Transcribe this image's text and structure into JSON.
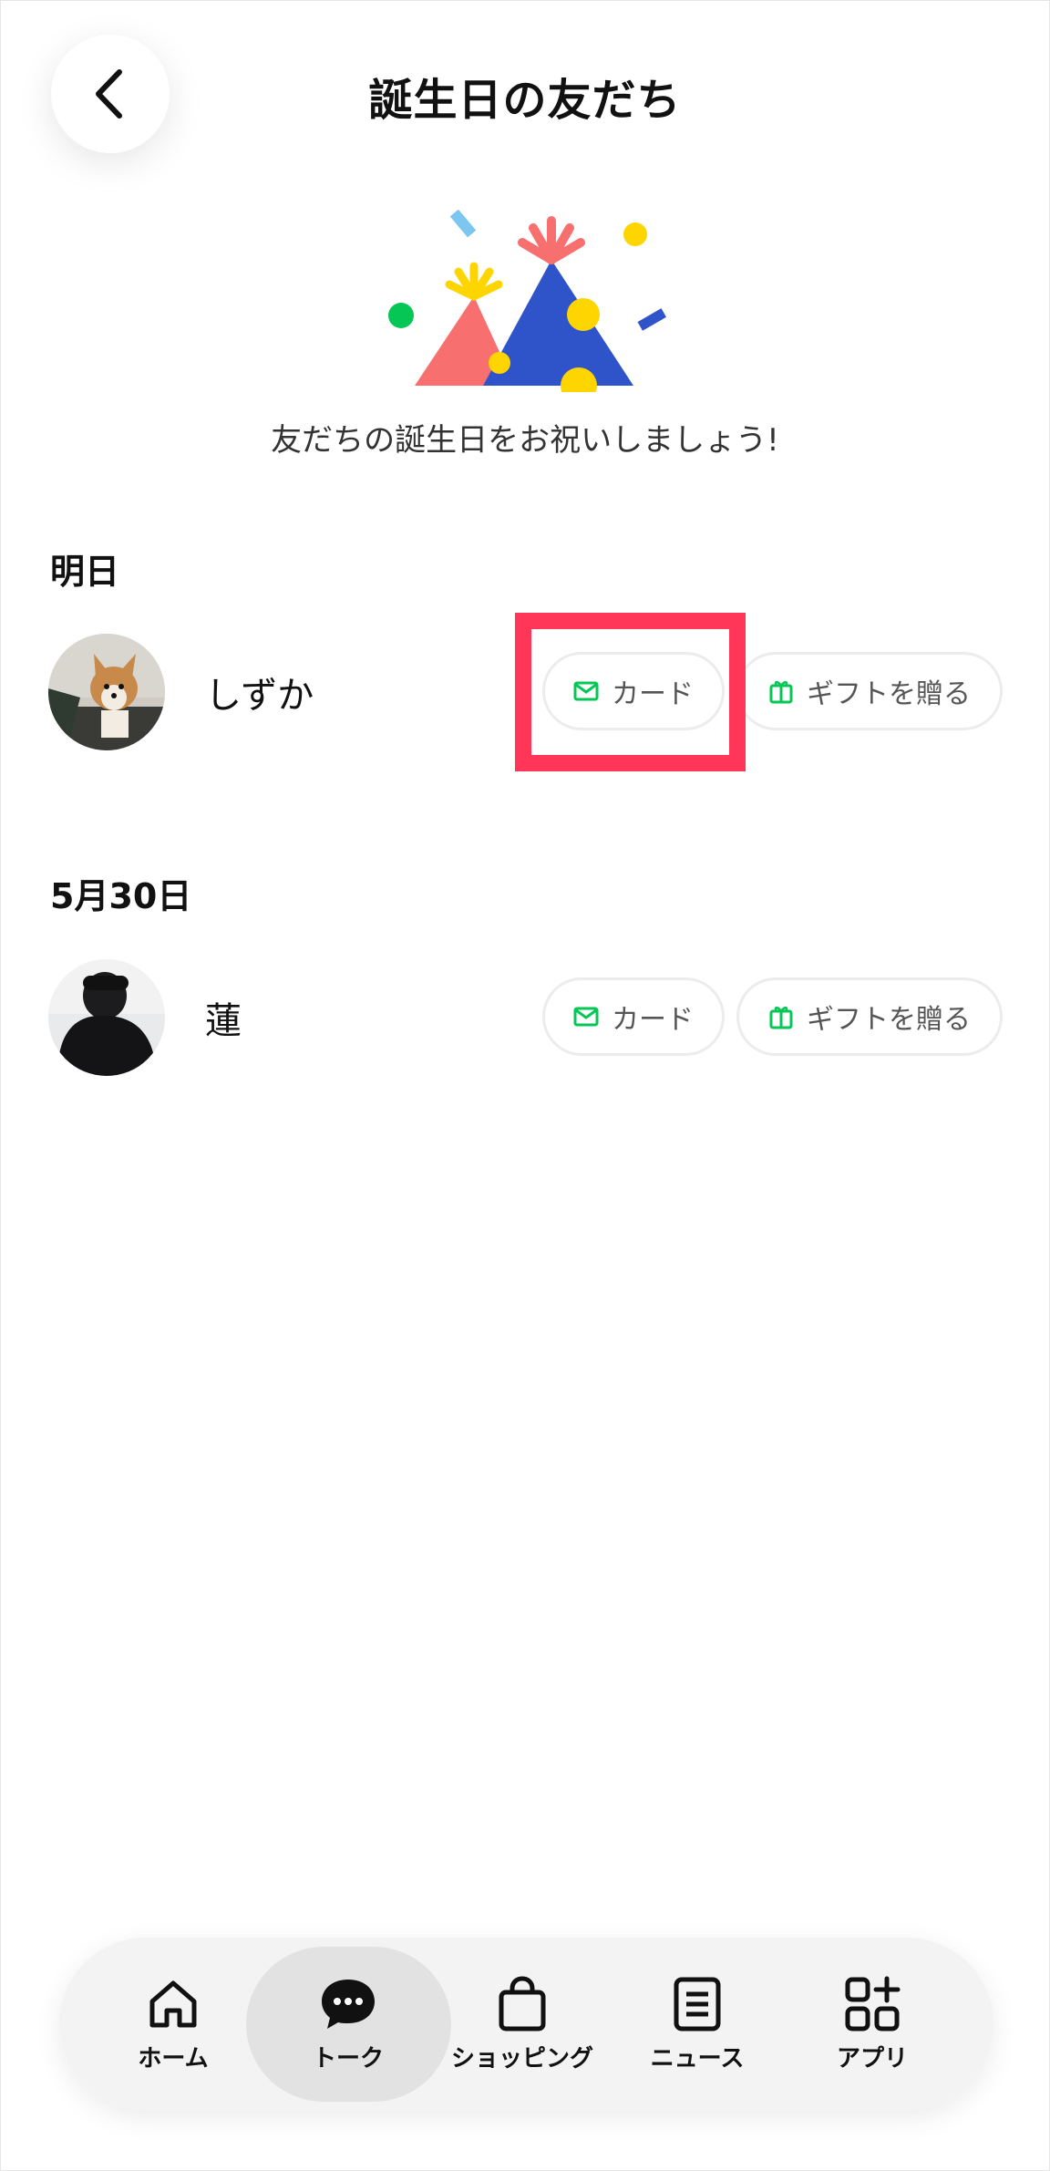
{
  "header": {
    "title": "誕生日の友だち",
    "back_icon": "chevron-left-icon"
  },
  "hero": {
    "subtitle": "友だちの誕生日をお祝いしましょう!"
  },
  "sections": [
    {
      "label": "明日",
      "friends": [
        {
          "name": "しずか",
          "card_label": "カード",
          "gift_label": "ギフトを贈る",
          "highlighted": "card"
        }
      ]
    },
    {
      "label": "5月30日",
      "friends": [
        {
          "name": "蓮",
          "card_label": "カード",
          "gift_label": "ギフトを贈る"
        }
      ]
    }
  ],
  "nav": {
    "items": [
      {
        "label": "ホーム",
        "icon": "home-icon"
      },
      {
        "label": "トーク",
        "icon": "chat-bubble-icon",
        "active": true
      },
      {
        "label": "ショッピング",
        "icon": "shopping-bag-icon"
      },
      {
        "label": "ニュース",
        "icon": "news-icon"
      },
      {
        "label": "アプリ",
        "icon": "apps-icon"
      }
    ]
  },
  "colors": {
    "accent_green": "#06c755",
    "highlight_red": "#ff3657",
    "party_blue": "#2f54c9",
    "party_pink": "#f76f6f",
    "party_yellow": "#ffd500"
  }
}
